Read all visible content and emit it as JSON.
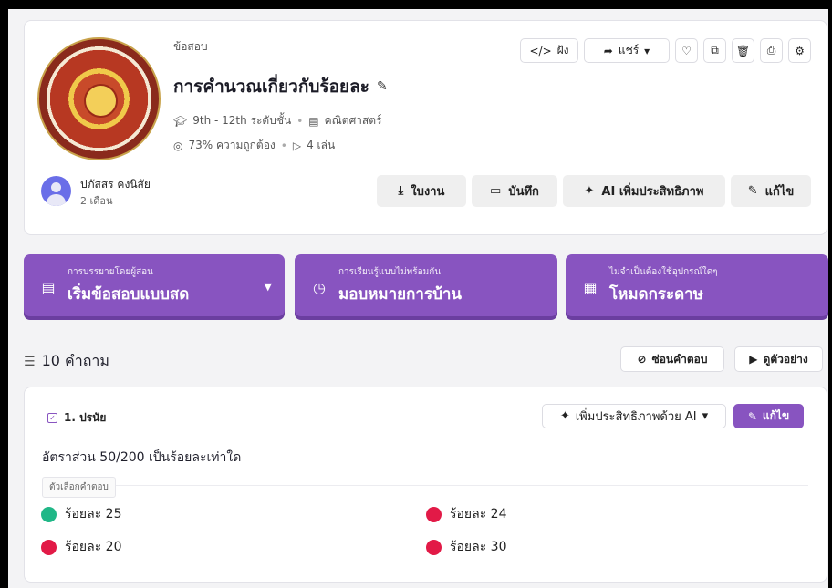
{
  "colors": {
    "accent": "#8854c0",
    "correct": "#20b787",
    "incorrect": "#e21a47"
  },
  "quiz": {
    "kind": "ข้อสอบ",
    "title": "การคำนวณเกี่ยวกับร้อยละ",
    "grade": "9th - 12th ระดับชั้น",
    "subject": "คณิตศาสตร์",
    "accuracy": "73% ความถูกต้อง",
    "plays": "4 เล่น",
    "logo_text": "NAKHONSAWAN VOCATIONAL COLLEGE"
  },
  "top_actions": {
    "embed": "ฝัง",
    "share": "แชร์"
  },
  "author": {
    "name": "ปภัสสร คงนิสัย",
    "time": "2 เดือน"
  },
  "bottom_actions": {
    "worksheet": "ใบงาน",
    "save": "บันทึก",
    "ai_enhance": "AI เพิ่มประสิทธิภาพ",
    "edit": "แก้ไข"
  },
  "modes": [
    {
      "sub": "การบรรยายโดยผู้สอน",
      "main": "เริ่มข้อสอบแบบสด"
    },
    {
      "sub": "การเรียนรู้แบบไม่พร้อมกัน",
      "main": "มอบหมายการบ้าน"
    },
    {
      "sub": "ไม่จำเป็นต้องใช้อุปกรณ์ใดๆ",
      "main": "โหมดกระดาษ"
    }
  ],
  "questions_header": {
    "count": "10 คำถาม",
    "hide_answers": "ซ่อนคำตอบ",
    "preview": "ดูตัวอย่าง"
  },
  "question": {
    "label": "1. ปรนัย",
    "ai_enhance": "เพิ่มประสิทธิภาพด้วย AI",
    "edit": "แก้ไข",
    "text": "อัตราส่วน 50/200 เป็นร้อยละเท่าใด",
    "options_label": "ตัวเลือกคำตอบ",
    "options": [
      {
        "text": "ร้อยละ 25",
        "correct": true
      },
      {
        "text": "ร้อยละ 24",
        "correct": false
      },
      {
        "text": "ร้อยละ 20",
        "correct": false
      },
      {
        "text": "ร้อยละ 30",
        "correct": false
      }
    ]
  }
}
